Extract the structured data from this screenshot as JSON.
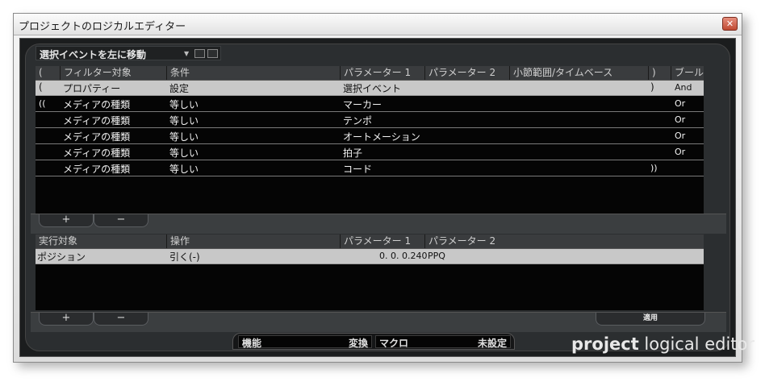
{
  "window": {
    "title": "プロジェクトのロジカルエディター",
    "close": "✕"
  },
  "preset": {
    "label": "選択イベントを左に移動"
  },
  "filter": {
    "headers": [
      "(",
      "フィルター対象",
      "条件",
      "パラメーター 1",
      "パラメーター 2",
      "小節範囲/タイムベース",
      ")",
      "ブール"
    ],
    "rows": [
      {
        "open": "(",
        "target": "プロパティー",
        "cond": "設定",
        "p1": "選択イベント",
        "p2": "",
        "range": "",
        "close": ")",
        "bool": "And"
      },
      {
        "open": "((",
        "target": "メディアの種類",
        "cond": "等しい",
        "p1": "マーカー",
        "p2": "",
        "range": "",
        "close": "",
        "bool": "Or"
      },
      {
        "open": "",
        "target": "メディアの種類",
        "cond": "等しい",
        "p1": "テンポ",
        "p2": "",
        "range": "",
        "close": "",
        "bool": "Or"
      },
      {
        "open": "",
        "target": "メディアの種類",
        "cond": "等しい",
        "p1": "オートメーション",
        "p2": "",
        "range": "",
        "close": "",
        "bool": "Or"
      },
      {
        "open": "",
        "target": "メディアの種類",
        "cond": "等しい",
        "p1": "拍子",
        "p2": "",
        "range": "",
        "close": "",
        "bool": "Or"
      },
      {
        "open": "",
        "target": "メディアの種類",
        "cond": "等しい",
        "p1": "コード",
        "p2": "",
        "range": "",
        "close": "))",
        "bool": ""
      }
    ]
  },
  "buttons": {
    "add": "+",
    "remove": "−",
    "apply": "適用"
  },
  "action": {
    "headers": [
      "実行対象",
      "操作",
      "パラメーター 1",
      "パラメーター 2"
    ],
    "rows": [
      {
        "target": "ポジション",
        "op": "引く(-)",
        "p1": "0. 0. 0.240",
        "p2": "PPQ"
      }
    ]
  },
  "bottom": {
    "function_label": "機能",
    "function_value": "変換",
    "macro_label": "マクロ",
    "macro_value": "未設定"
  },
  "logo": {
    "bold": "project",
    "rest": " logical editor"
  }
}
